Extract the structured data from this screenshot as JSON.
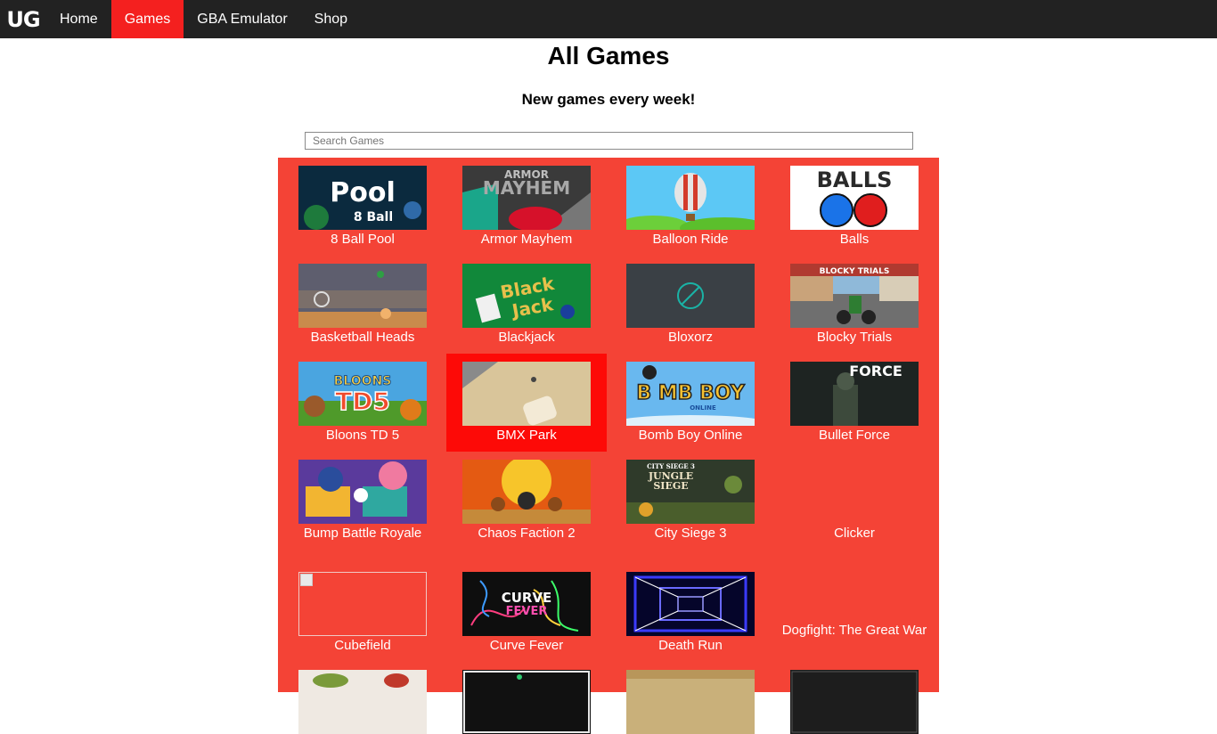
{
  "nav": {
    "logo": "UG",
    "items": [
      {
        "label": "Home"
      },
      {
        "label": "Games"
      },
      {
        "label": "GBA Emulator"
      },
      {
        "label": "Shop"
      }
    ]
  },
  "header": {
    "title": "All Games",
    "subtitle": "New games every week!"
  },
  "search": {
    "placeholder": "Search Games",
    "value": ""
  },
  "colors": {
    "navbar": "#222222",
    "accent": "#f4201f",
    "panel": "#f44336",
    "selected_tile": "#fd0a07"
  },
  "games": [
    {
      "title": "8 Ball Pool",
      "thumb_text": [
        "Pool",
        "8 Ball"
      ]
    },
    {
      "title": "Armor Mayhem",
      "thumb_text": [
        "ARMOR",
        "MAYHEM"
      ]
    },
    {
      "title": "Balloon Ride"
    },
    {
      "title": "Balls",
      "thumb_text": [
        "BALLS"
      ]
    },
    {
      "title": "Basketball Heads"
    },
    {
      "title": "Blackjack",
      "thumb_text": [
        "Black",
        "Jack"
      ]
    },
    {
      "title": "Bloxorz"
    },
    {
      "title": "Blocky Trials",
      "thumb_text": [
        "BLOCKY TRIALS"
      ]
    },
    {
      "title": "Bloons TD 5",
      "thumb_text": [
        "BLOONS",
        "TD5"
      ]
    },
    {
      "title": "BMX Park",
      "selected": true
    },
    {
      "title": "Bomb Boy Online",
      "thumb_text": [
        "B MB BOY",
        "ONLINE"
      ]
    },
    {
      "title": "Bullet Force",
      "thumb_text": [
        "FORCE"
      ]
    },
    {
      "title": "Bump Battle Royale"
    },
    {
      "title": "Chaos Faction 2"
    },
    {
      "title": "City Siege 3",
      "thumb_text": [
        "CITY SIEGE 3",
        "JUNGLE",
        "SIEGE"
      ]
    },
    {
      "title": "Clicker"
    },
    {
      "title": "Cubefield"
    },
    {
      "title": "Curve Fever",
      "thumb_text": [
        "CURVE",
        "FEVER"
      ]
    },
    {
      "title": "Death Run"
    },
    {
      "title": "Dogfight: The Great War"
    },
    {
      "title": ""
    },
    {
      "title": ""
    },
    {
      "title": ""
    },
    {
      "title": ""
    }
  ]
}
